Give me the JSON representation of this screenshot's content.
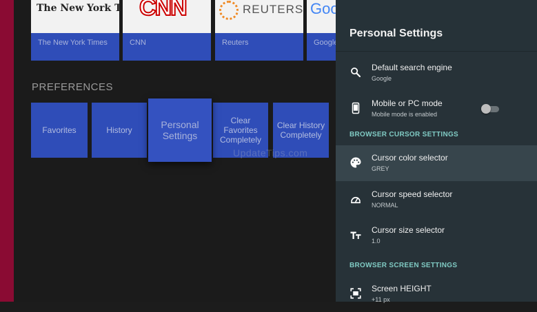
{
  "bookmarks": [
    {
      "logo": "The New York Times",
      "label": "The New York Times"
    },
    {
      "logo": "CNN",
      "label": "CNN"
    },
    {
      "logo": "REUTERS",
      "label": "Reuters"
    },
    {
      "logo": "Goo",
      "label": "Google"
    }
  ],
  "preferences": {
    "title": "PREFERENCES",
    "tiles": [
      {
        "label": "Favorites"
      },
      {
        "label": "History"
      },
      {
        "label": "Personal Settings"
      },
      {
        "label": "Clear Favorites Completely"
      },
      {
        "label": "Clear History Completely"
      }
    ]
  },
  "watermark": "UpdateTips.com",
  "panel": {
    "title": "Personal Settings",
    "items": [
      {
        "title": "Default search engine",
        "subtitle": "Google",
        "icon": "search-icon"
      },
      {
        "title": "Mobile or PC mode",
        "subtitle": "Mobile mode is enabled",
        "icon": "phone-icon",
        "toggle_on": false
      }
    ],
    "sections": [
      {
        "header": "BROWSER CURSOR SETTINGS",
        "items": [
          {
            "title": "Cursor color selector",
            "subtitle": "GREY",
            "icon": "palette-icon"
          },
          {
            "title": "Cursor speed selector",
            "subtitle": "NORMAL",
            "icon": "speedometer-icon"
          },
          {
            "title": "Cursor size selector",
            "subtitle": "1.0",
            "icon": "text-size-icon"
          }
        ]
      },
      {
        "header": "BROWSER SCREEN SETTINGS",
        "items": [
          {
            "title": "Screen HEIGHT",
            "subtitle": "+11 px",
            "icon": "fullscreen-icon"
          }
        ]
      }
    ]
  }
}
